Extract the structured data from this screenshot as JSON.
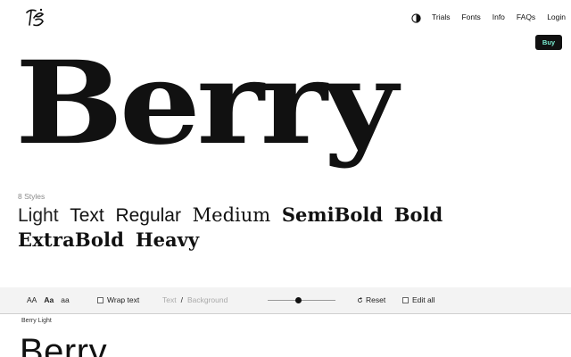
{
  "header": {
    "logo_name": "type-foundry-logo",
    "nav": [
      "Trials",
      "Fonts",
      "Info",
      "FAQs",
      "Login"
    ],
    "buy_label": "Buy",
    "buy_text_color": "#7cf0d4"
  },
  "hero": {
    "title": "Berry"
  },
  "styles": {
    "count_label": "8 Styles",
    "weights": [
      "Light",
      "Text",
      "Regular",
      "Medium",
      "SemiBold",
      "Bold",
      "ExtraBold",
      "Heavy"
    ]
  },
  "toolbar": {
    "case_options": [
      "AA",
      "Aa",
      "aa"
    ],
    "active_case": "Aa",
    "wrap_text_label": "Wrap text",
    "text_label": "Text",
    "separator": "/",
    "background_label": "Background",
    "size_slider_value": 0.45,
    "reset_label": "Reset",
    "edit_all_label": "Edit all"
  },
  "preview": {
    "label": "Berry Light",
    "text": "Berry"
  }
}
